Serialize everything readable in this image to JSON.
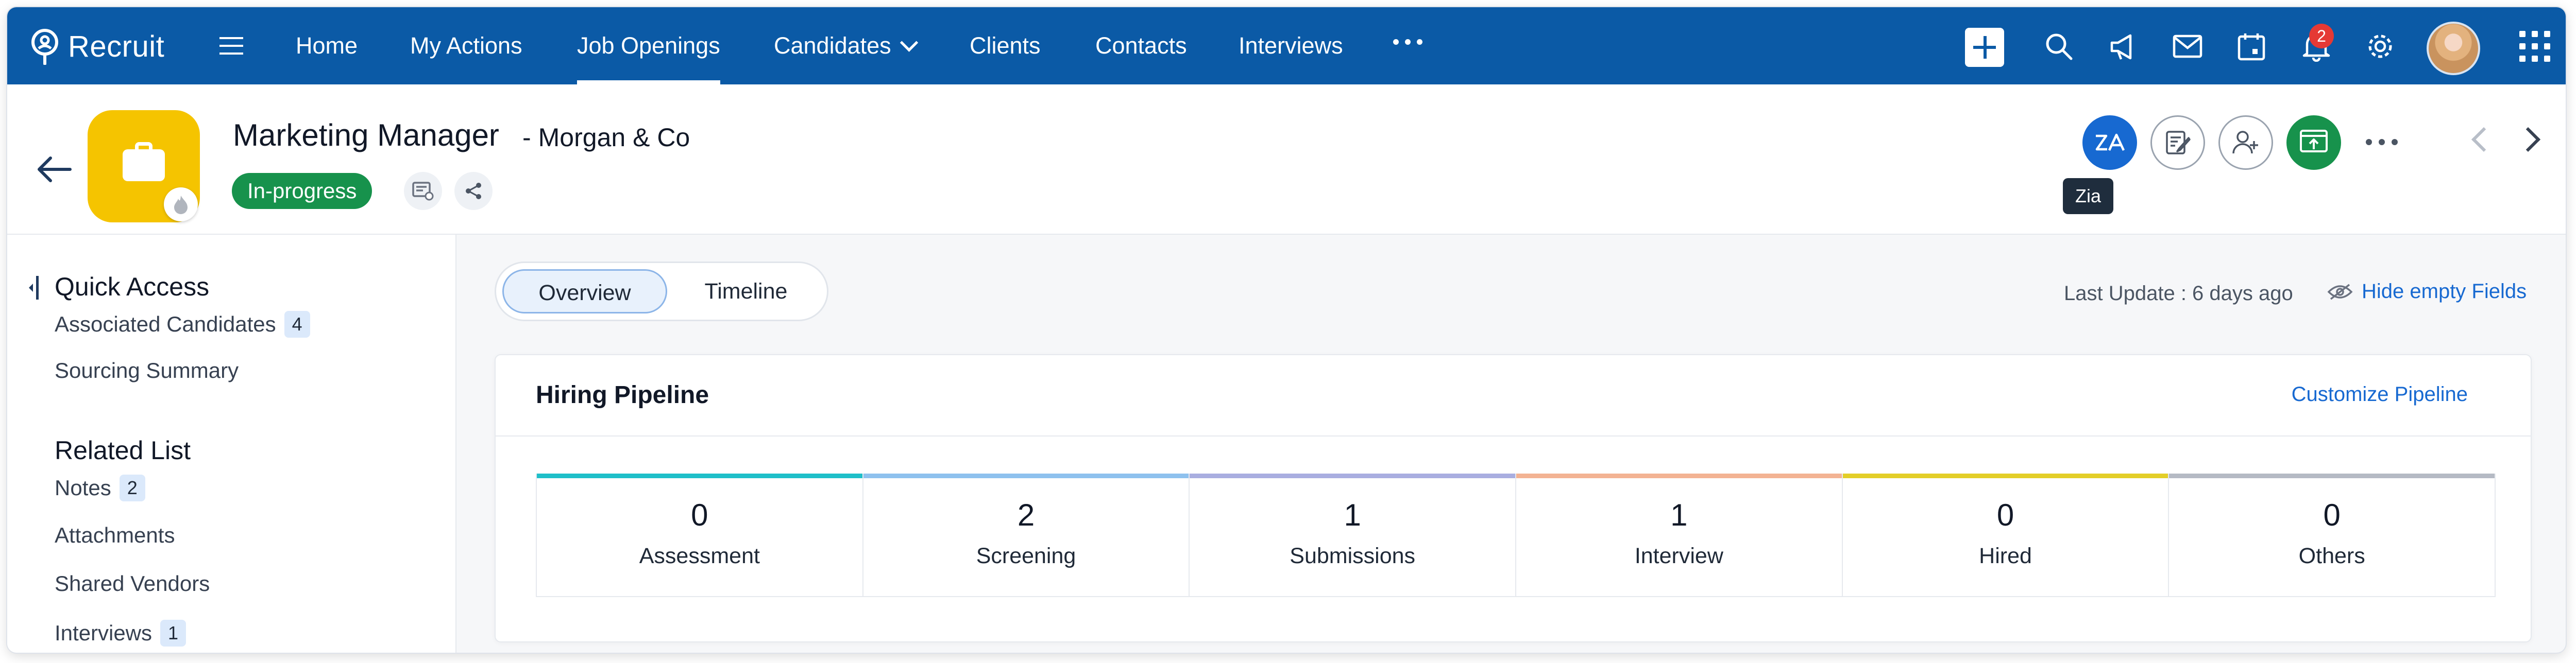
{
  "app": {
    "name": "Recruit"
  },
  "nav": {
    "items": [
      {
        "label": "Home"
      },
      {
        "label": "My Actions"
      },
      {
        "label": "Job Openings",
        "active": true
      },
      {
        "label": "Candidates",
        "has_dropdown": true
      },
      {
        "label": "Clients"
      },
      {
        "label": "Contacts"
      },
      {
        "label": "Interviews"
      }
    ],
    "more_icon": "more-horizontal-icon",
    "toolbar_icons": [
      "plus-icon",
      "search-icon",
      "megaphone-icon",
      "mail-icon",
      "calendar-icon",
      "bell-icon",
      "gear-icon",
      "avatar",
      "apps-grid-icon"
    ],
    "notification_count": "2"
  },
  "record": {
    "title": "Marketing Manager",
    "separator": "-",
    "client": "Morgan & Co",
    "status": "In-progress",
    "status_color": "#17924c",
    "icon_color": "#f5c400",
    "actions": [
      "zia-icon",
      "edit-note-icon",
      "add-user-icon",
      "publish-icon"
    ],
    "tooltip": "Zia"
  },
  "sidebar": {
    "quick_access": {
      "heading": "Quick Access",
      "items": [
        {
          "label": "Associated Candidates",
          "count": "4"
        },
        {
          "label": "Sourcing Summary"
        }
      ]
    },
    "related_list": {
      "heading": "Related List",
      "items": [
        {
          "label": "Notes",
          "count": "2"
        },
        {
          "label": "Attachments"
        },
        {
          "label": "Shared Vendors"
        },
        {
          "label": "Interviews",
          "count": "1"
        }
      ]
    }
  },
  "main": {
    "tabs": [
      {
        "label": "Overview",
        "active": true
      },
      {
        "label": "Timeline"
      }
    ],
    "last_update": "Last Update : 6 days ago",
    "hide_empty": "Hide empty Fields",
    "pipeline": {
      "title": "Hiring Pipeline",
      "customize_label": "Customize Pipeline",
      "stages": [
        {
          "count": "0",
          "label": "Assessment",
          "color": "#1fbfc9"
        },
        {
          "count": "2",
          "label": "Screening",
          "color": "#8ec1ee"
        },
        {
          "count": "1",
          "label": "Submissions",
          "color": "#a9aee0"
        },
        {
          "count": "1",
          "label": "Interview",
          "color": "#f3b393"
        },
        {
          "count": "0",
          "label": "Hired",
          "color": "#e3ce28"
        },
        {
          "count": "0",
          "label": "Others",
          "color": "#b5bac4"
        }
      ]
    }
  },
  "colors": {
    "primary": "#0b5aa6",
    "link": "#1769d1",
    "accent_zia": "#1769d1"
  }
}
